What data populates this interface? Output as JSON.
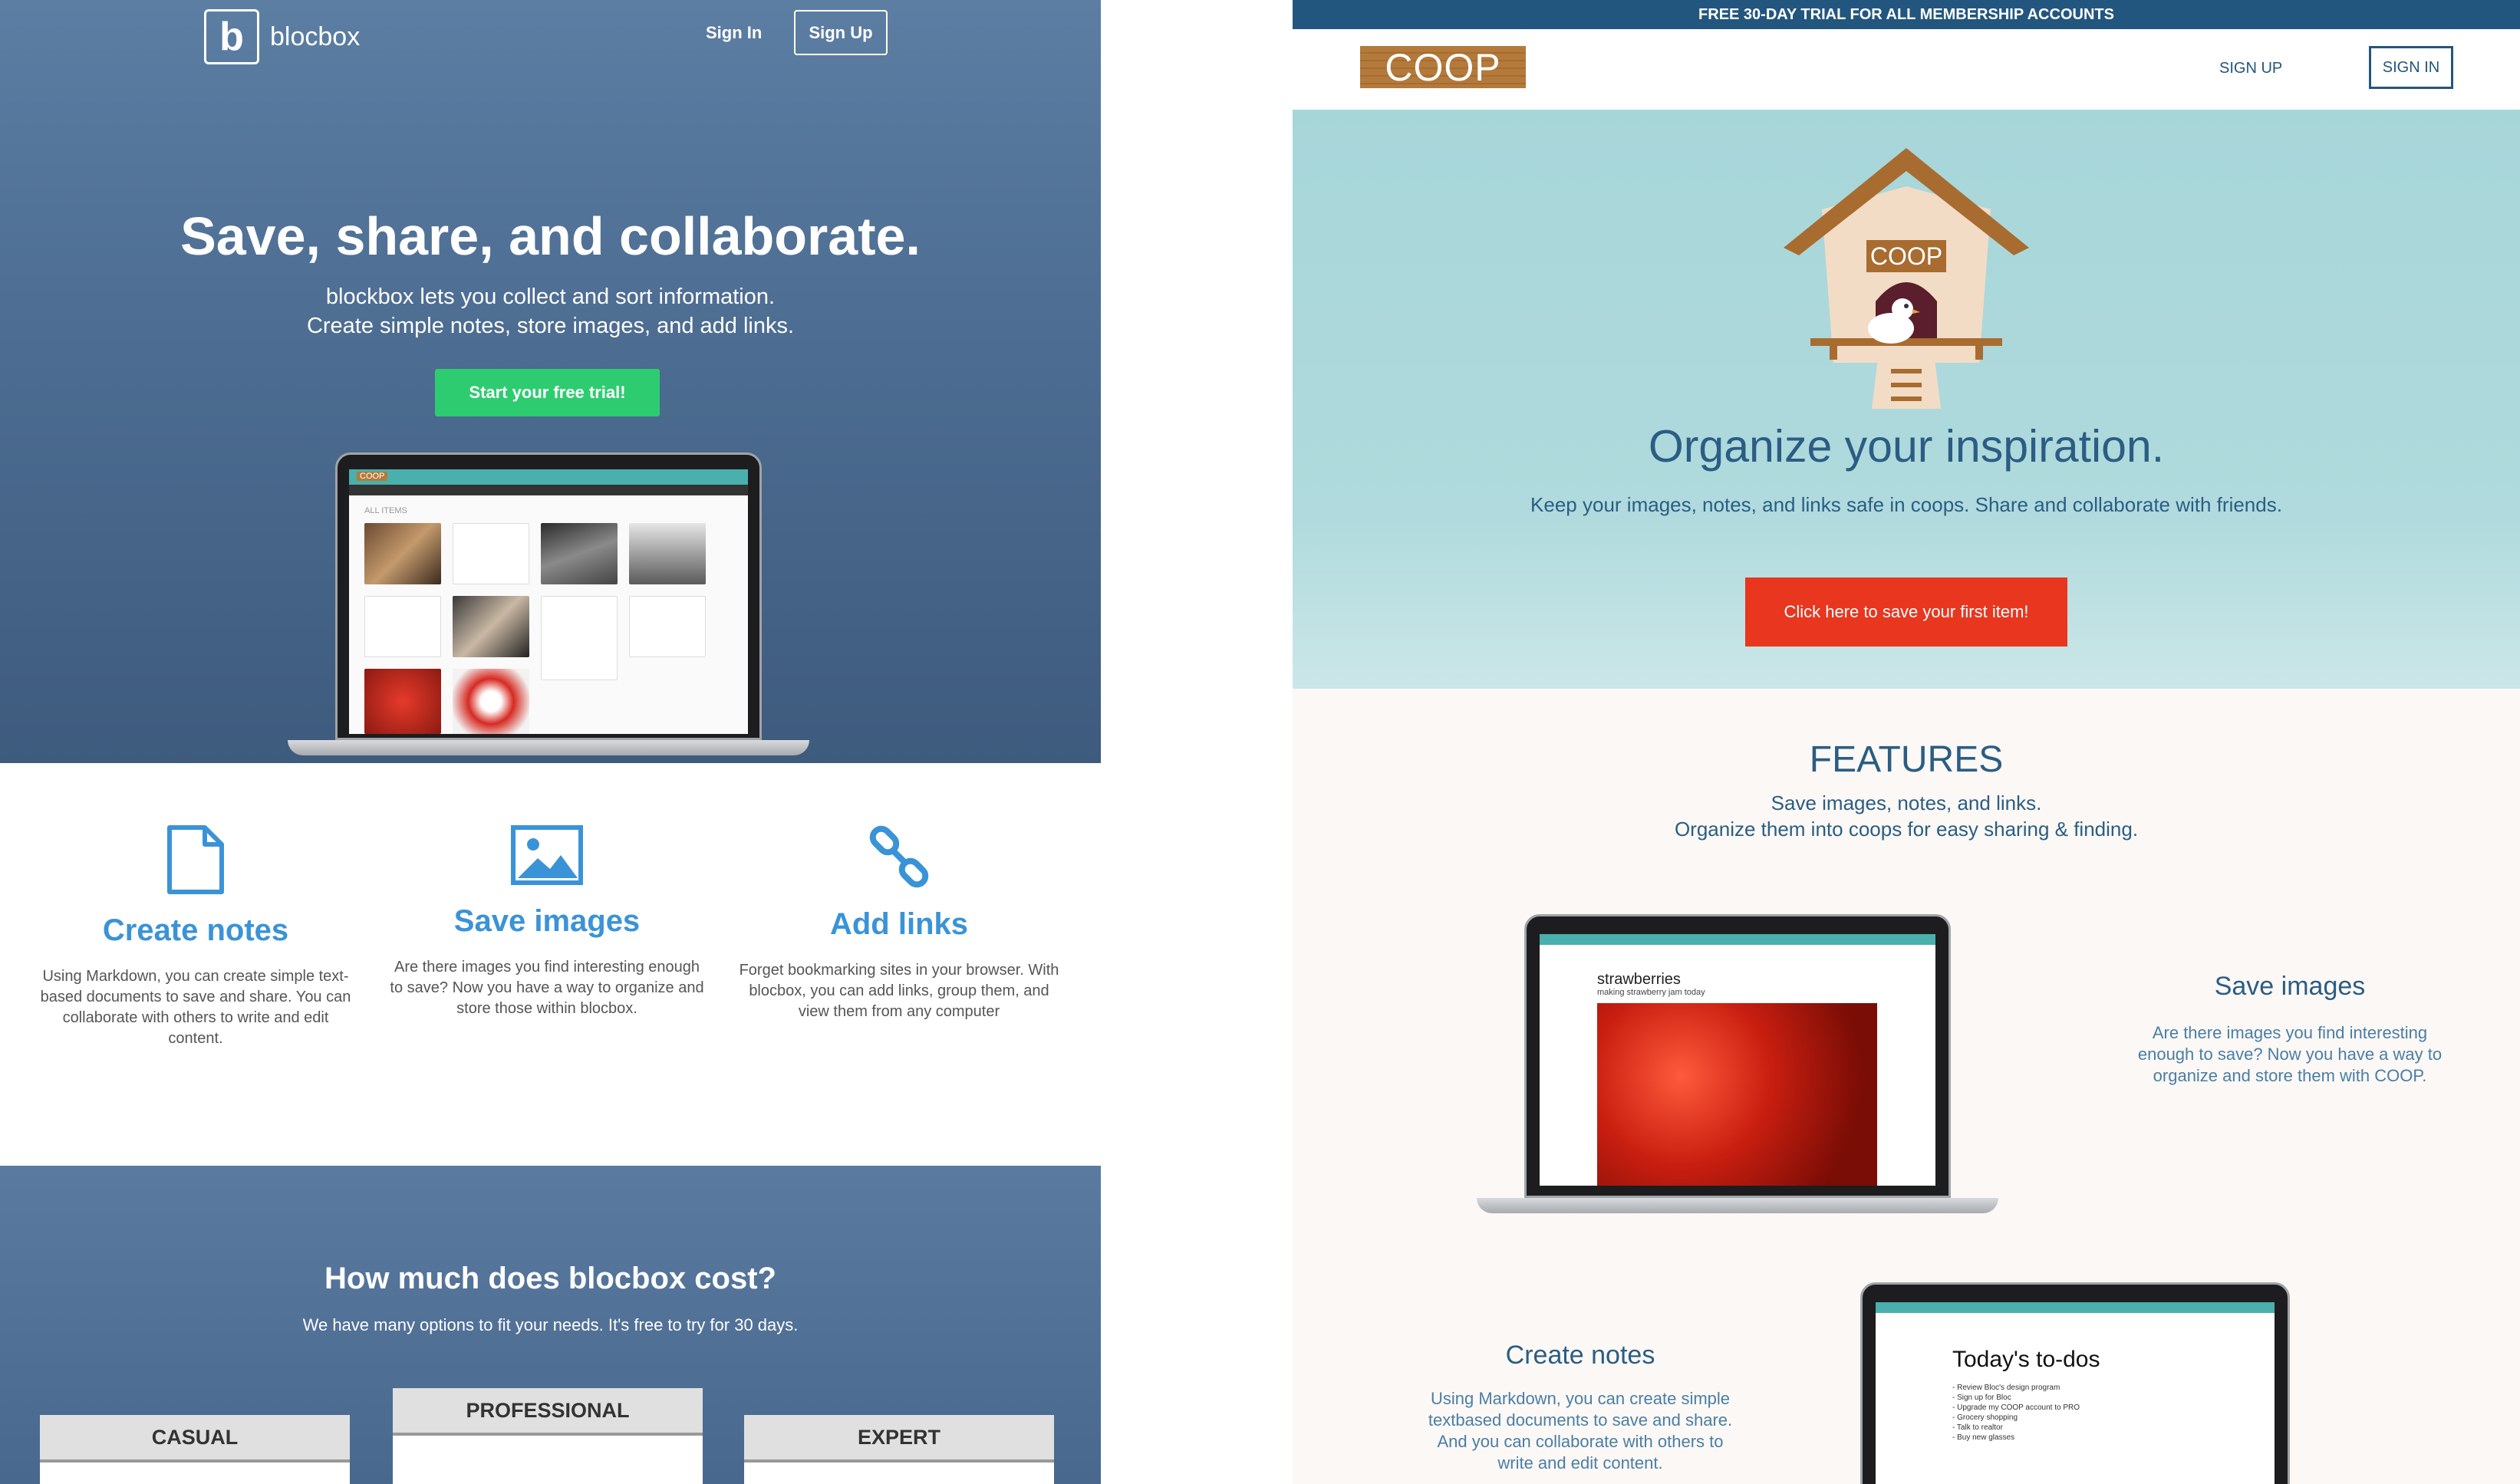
{
  "blocbox": {
    "logo_letter": "b",
    "logo_text": "blocbox",
    "signin": "Sign In",
    "signup": "Sign Up",
    "hero_title": "Save, share, and collaborate.",
    "hero_sub_1": "blockbox lets you collect and sort information.",
    "hero_sub_2": "Create simple notes, store images, and add links.",
    "cta": "Start your free trial!",
    "laptop_screen": {
      "logo": "COOP",
      "heading": "ALL ITEMS"
    },
    "features": [
      {
        "icon": "document-icon",
        "title": "Create notes",
        "desc": "Using Markdown, you can create simple text-based documents to save and share. You can collaborate with others to write and edit content."
      },
      {
        "icon": "image-icon",
        "title": "Save images",
        "desc": "Are there images you find interesting enough to save? Now you have a way to organize and store those within blocbox."
      },
      {
        "icon": "link-icon",
        "title": "Add links",
        "desc": "Forget bookmarking sites in your browser. With blocbox, you can add links, group them, and view them from any computer"
      }
    ],
    "pricing_title": "How much does blocbox cost?",
    "pricing_sub": "We have many options to fit your needs. It's free to try for 30 days.",
    "plans": [
      "CASUAL",
      "PROFESSIONAL",
      "EXPERT"
    ]
  },
  "coop": {
    "topbar": "FREE 30-DAY TRIAL FOR ALL MEMBERSHIP ACCOUNTS",
    "logo": "COOP",
    "signup": "SIGN UP",
    "signin": "SIGN IN",
    "house_sign": "COOP",
    "hero_title": "Organize your inspiration.",
    "hero_sub": "Keep your images, notes, and links safe in coops. Share and collaborate with friends.",
    "cta": "Click here to save your first item!",
    "features_title": "FEATURES",
    "features_sub_1": "Save images, notes, and links.",
    "features_sub_2": "Organize them into coops for easy sharing & finding.",
    "laptop_item": {
      "title": "strawberries",
      "caption": "making strawberry jam today"
    },
    "save_images_title": "Save images",
    "save_images_desc": "Are there images you find interesting enough to save? Now you have a way to organize and store them with COOP.",
    "create_notes_title": "Create notes",
    "create_notes_desc": "Using Markdown, you can create simple textbased documents to save and share. And you can collaborate with others to write and edit content.",
    "todo": {
      "title": "Today's to-dos",
      "items": [
        "- Review Bloc's design program",
        "- Sign up for Bloc",
        "- Upgrade my COOP account to PRO",
        "- Grocery shopping",
        "- Talk to realtor",
        "- Buy new glasses"
      ]
    },
    "colors": {
      "accent": "#e8361f",
      "primary": "#23567e",
      "hero_bg": "#a7d6d9",
      "wood": "#b37a3b"
    }
  }
}
